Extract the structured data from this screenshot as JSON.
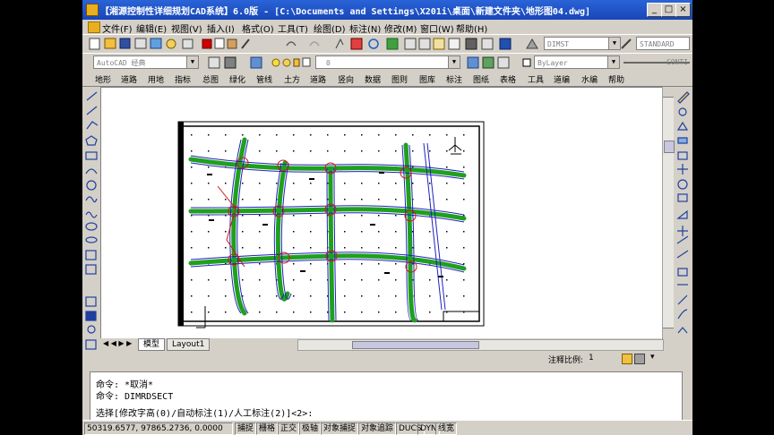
{
  "window": {
    "title": "【湘源控制性详细规划CAD系统】6.0版 - [C:\\Documents and Settings\\X201i\\桌面\\新建文件夹\\地形图04.dwg]"
  },
  "menu": [
    "文件(F)",
    "编辑(E)",
    "视图(V)",
    "插入(I)",
    "格式(O)",
    "工具(T)",
    "绘图(D)",
    "标注(N)",
    "修改(M)",
    "窗口(W)",
    "帮助(H)"
  ],
  "toolbar": {
    "dimstyle": "DIMST",
    "textstyle": "STANDARD",
    "workspace": "AutoCAD 经典",
    "layer": "0",
    "color": "ByLayer",
    "linetype": "CONTI"
  },
  "cmd_menu": [
    "地形",
    "道路",
    "用地",
    "指标",
    "总图",
    "绿化",
    "管线",
    "土方",
    "道路",
    "竖向",
    "数据",
    "图则",
    "图库",
    "标注",
    "图纸",
    "表格",
    "工具",
    "道编",
    "水编",
    "帮助"
  ],
  "tabs": {
    "model": "模型",
    "layout": "Layout1"
  },
  "annotation": {
    "label": "注释比例:",
    "value": "1"
  },
  "command": {
    "line1": "命令: *取消*",
    "line2": "命令: DIMRDSECT",
    "line3": "选择[修改字高(0)/自动标注(1)/人工标注(2)]<2>:"
  },
  "status": {
    "coords": "50319.6577, 97865.2736, 0.0000",
    "toggles": [
      "捕捉",
      "栅格",
      "正交",
      "极轴",
      "对象捕捉",
      "对象追踪",
      "DUCS",
      "DYN",
      "线宽"
    ]
  },
  "colors": {
    "title": "#1a4cc4",
    "road_green": "#1fa01f",
    "road_blue": "#2020c0",
    "road_red": "#d01818"
  }
}
